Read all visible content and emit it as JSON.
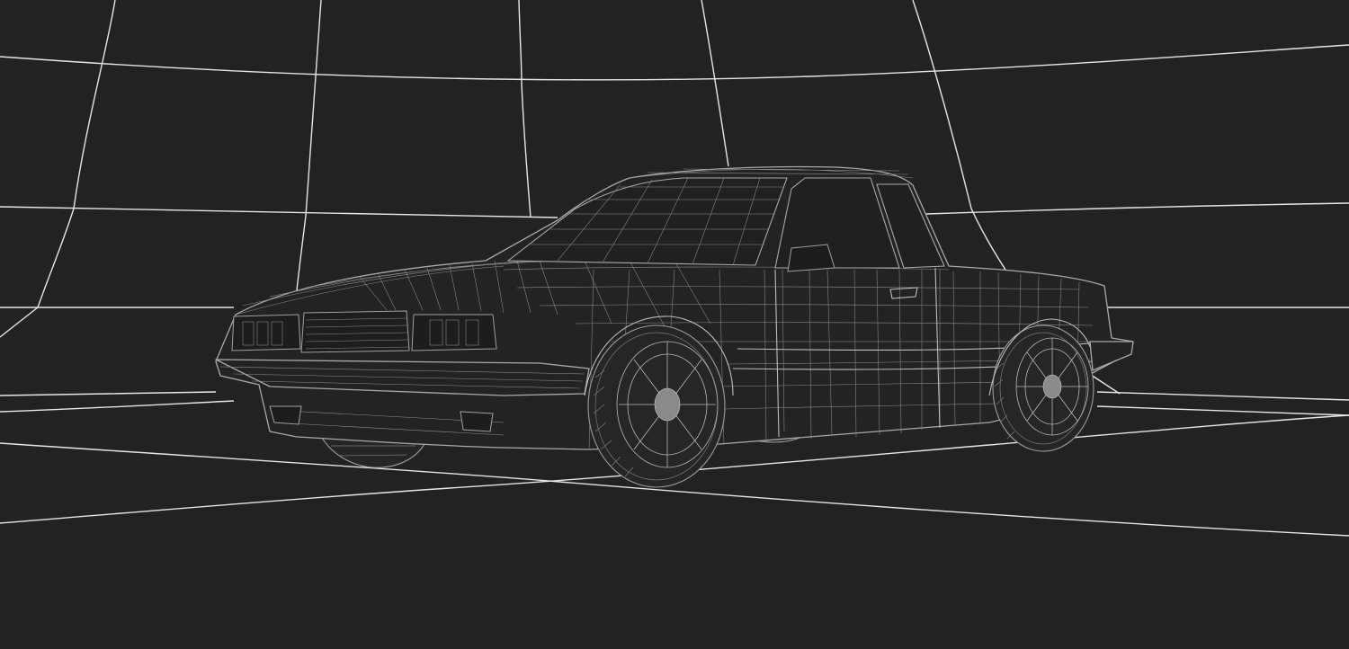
{
  "scene": {
    "subject": "car-wireframe",
    "background_color": "#222222",
    "grid_color": "#e6e6e6",
    "wire_color": "#a9a9a9"
  }
}
